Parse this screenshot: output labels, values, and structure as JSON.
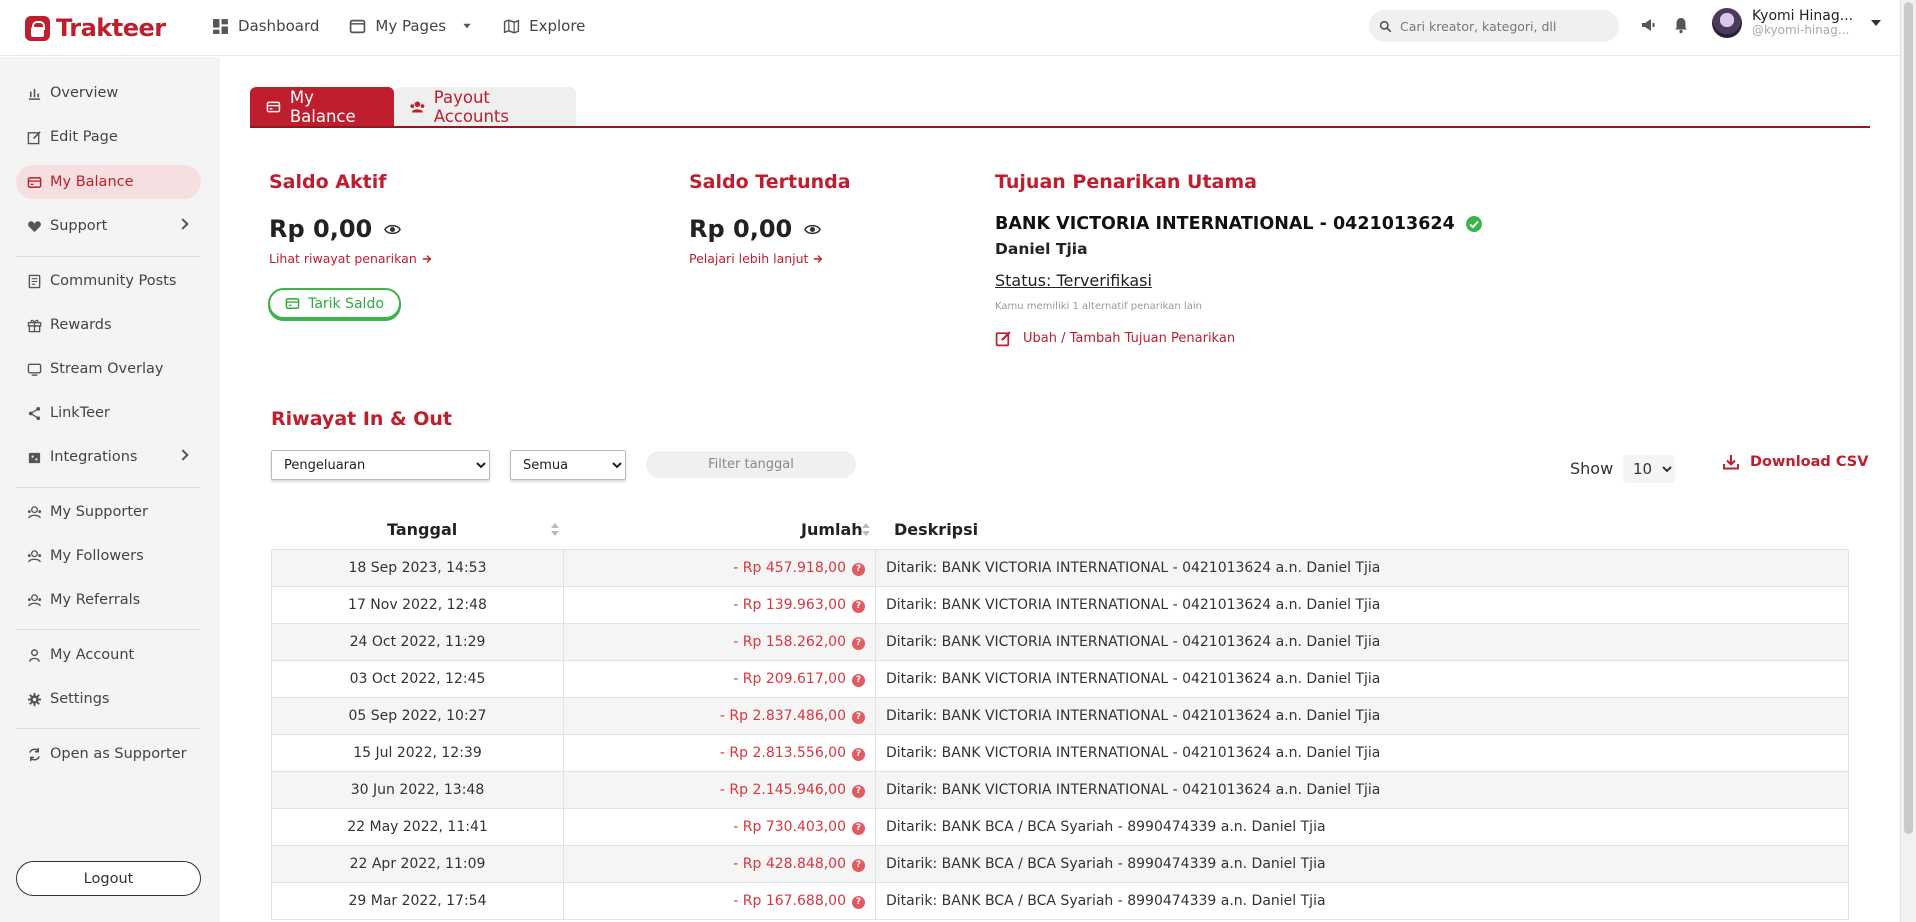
{
  "brand": {
    "name": "Trakteer"
  },
  "topnav": [
    {
      "label": "Dashboard",
      "icon": "dashboard-icon"
    },
    {
      "label": "My Pages",
      "icon": "pages-icon"
    },
    {
      "label": "Explore",
      "icon": "explore-icon"
    }
  ],
  "search": {
    "placeholder": "Cari kreator, kategori, dll"
  },
  "user": {
    "name": "Kyomi Hinag...",
    "handle": "@kyomi-hinag..."
  },
  "sidebar": {
    "items": [
      {
        "label": "Overview",
        "icon": "overview-icon"
      },
      {
        "label": "Edit Page",
        "icon": "edit-page-icon"
      },
      {
        "label": "My Balance",
        "icon": "wallet-icon"
      },
      {
        "label": "Support",
        "icon": "heart-icon"
      },
      {
        "label": "Community Posts",
        "icon": "posts-icon"
      },
      {
        "label": "Rewards",
        "icon": "gift-icon"
      },
      {
        "label": "Stream Overlay",
        "icon": "stream-icon"
      },
      {
        "label": "LinkTeer",
        "icon": "share-icon"
      },
      {
        "label": "Integrations",
        "icon": "puzzle-icon"
      },
      {
        "label": "My Supporter",
        "icon": "users-icon"
      },
      {
        "label": "My Followers",
        "icon": "users-icon"
      },
      {
        "label": "My Referrals",
        "icon": "users-icon"
      },
      {
        "label": "My Account",
        "icon": "user-icon"
      },
      {
        "label": "Settings",
        "icon": "gear-icon"
      },
      {
        "label": "Open as Supporter",
        "icon": "swap-icon"
      }
    ],
    "logout": "Logout"
  },
  "tabs": [
    {
      "label": "My Balance"
    },
    {
      "label": "Payout Accounts"
    }
  ],
  "balance": {
    "active_title": "Saldo Aktif",
    "active_value": "Rp 0,00",
    "active_link": "Lihat riwayat penarikan",
    "withdraw_button": "Tarik Saldo",
    "pending_title": "Saldo Tertunda",
    "pending_value": "Rp 0,00",
    "pending_link": "Pelajari lebih lanjut"
  },
  "payout": {
    "title": "Tujuan Penarikan Utama",
    "bank": "BANK VICTORIA INTERNATIONAL - 0421013624",
    "owner": "Daniel Tjia",
    "status": "Status: Terverifikasi",
    "note": "Kamu memiliki 1 alternatif penarikan lain",
    "edit_link": "Ubah / Tambah Tujuan Penarikan"
  },
  "history": {
    "title": "Riwayat In & Out",
    "type_filter": "Pengeluaran",
    "scope_filter": "Semua",
    "date_placeholder": "Filter tanggal",
    "show_label": "Show",
    "show_value": "10",
    "download": "Download CSV",
    "columns": {
      "date": "Tanggal",
      "amount": "Jumlah",
      "desc": "Deskripsi"
    },
    "rows": [
      {
        "date": "18 Sep 2023, 14:53",
        "amount": "- Rp 457.918,00",
        "desc": "Ditarik: BANK VICTORIA INTERNATIONAL - 0421013624 a.n. Daniel Tjia"
      },
      {
        "date": "17 Nov 2022, 12:48",
        "amount": "- Rp 139.963,00",
        "desc": "Ditarik: BANK VICTORIA INTERNATIONAL - 0421013624 a.n. Daniel Tjia"
      },
      {
        "date": "24 Oct 2022, 11:29",
        "amount": "- Rp 158.262,00",
        "desc": "Ditarik: BANK VICTORIA INTERNATIONAL - 0421013624 a.n. Daniel Tjia"
      },
      {
        "date": "03 Oct 2022, 12:45",
        "amount": "- Rp 209.617,00",
        "desc": "Ditarik: BANK VICTORIA INTERNATIONAL - 0421013624 a.n. Daniel Tjia"
      },
      {
        "date": "05 Sep 2022, 10:27",
        "amount": "- Rp 2.837.486,00",
        "desc": "Ditarik: BANK VICTORIA INTERNATIONAL - 0421013624 a.n. Daniel Tjia"
      },
      {
        "date": "15 Jul 2022, 12:39",
        "amount": "- Rp 2.813.556,00",
        "desc": "Ditarik: BANK VICTORIA INTERNATIONAL - 0421013624 a.n. Daniel Tjia"
      },
      {
        "date": "30 Jun 2022, 13:48",
        "amount": "- Rp 2.145.946,00",
        "desc": "Ditarik: BANK VICTORIA INTERNATIONAL - 0421013624 a.n. Daniel Tjia"
      },
      {
        "date": "22 May 2022, 11:41",
        "amount": "- Rp 730.403,00",
        "desc": "Ditarik: BANK BCA / BCA Syariah - 8990474339 a.n. Daniel Tjia"
      },
      {
        "date": "22 Apr 2022, 11:09",
        "amount": "- Rp 428.848,00",
        "desc": "Ditarik: BANK BCA / BCA Syariah - 8990474339 a.n. Daniel Tjia"
      },
      {
        "date": "29 Mar 2022, 17:54",
        "amount": "- Rp 167.688,00",
        "desc": "Ditarik: BANK BCA / BCA Syariah - 8990474339 a.n. Daniel Tjia"
      }
    ]
  },
  "colors": {
    "brand": "#be1e2d",
    "success": "#3bb54a",
    "negative": "#d9363e"
  }
}
